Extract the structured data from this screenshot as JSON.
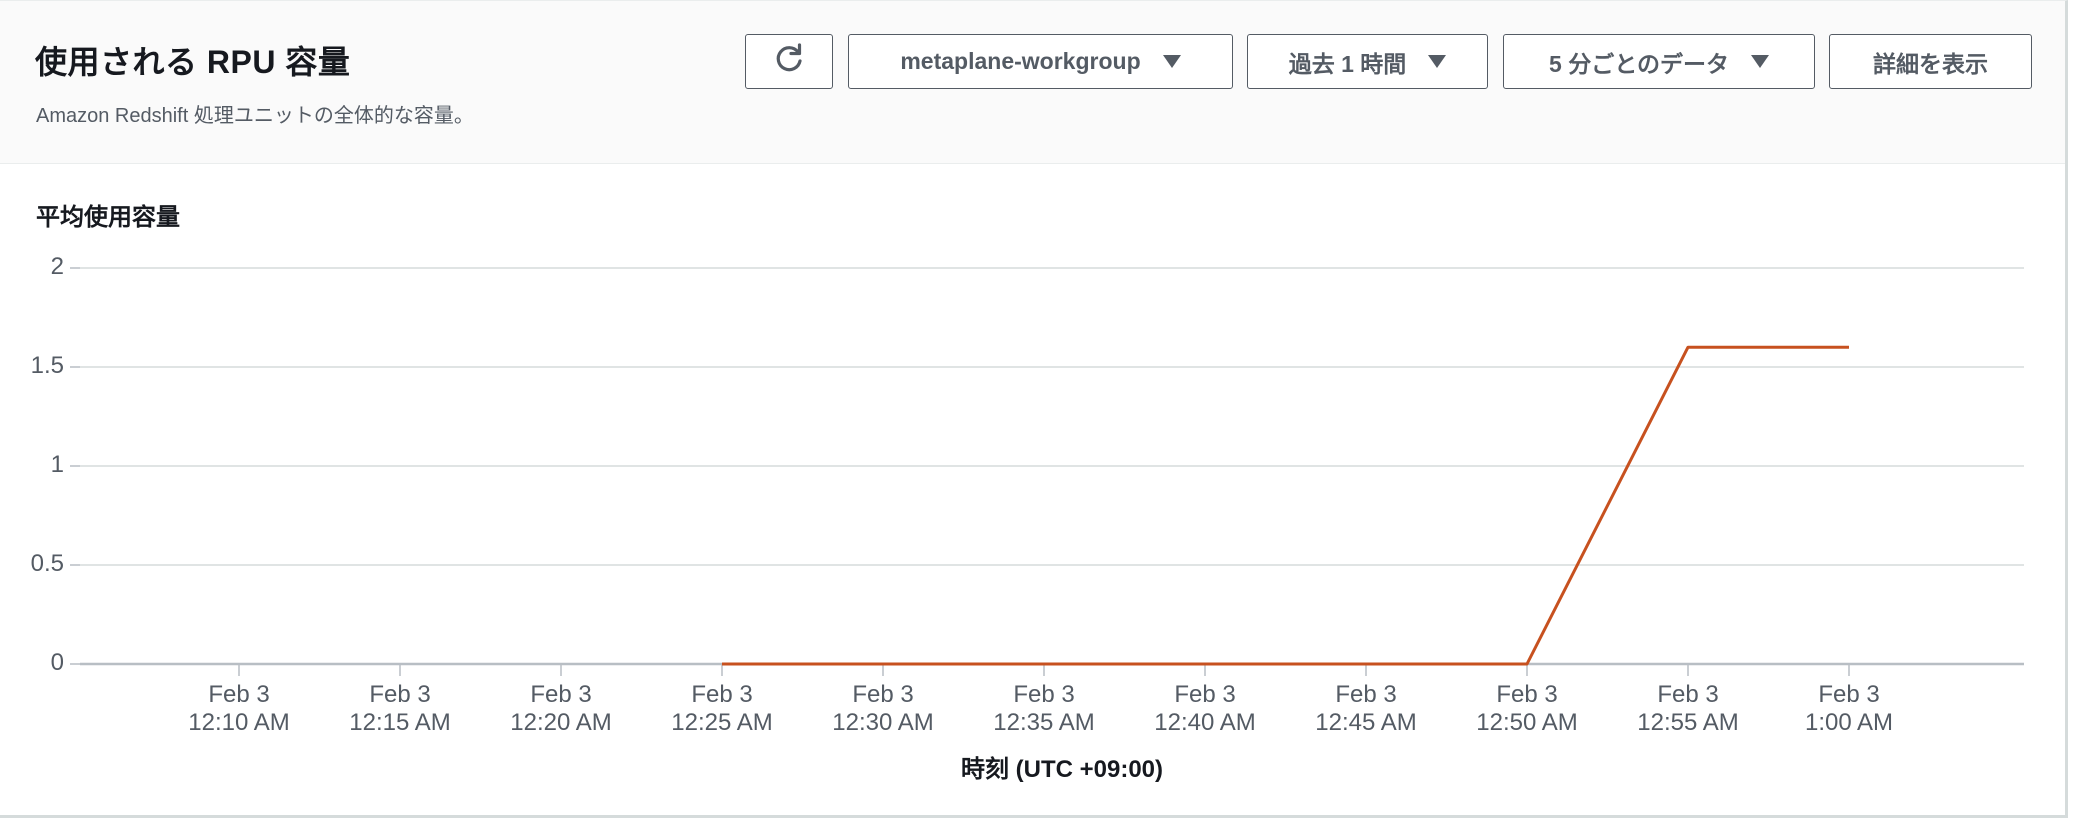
{
  "header": {
    "title": "使用される RPU 容量",
    "subtitle": "Amazon Redshift 処理ユニットの全体的な容量。"
  },
  "toolbar": {
    "refresh_icon": "refresh-icon",
    "workgroup": "metaplane-workgroup",
    "range": "過去 1 時間",
    "period": "5 分ごとのデータ",
    "details": "詳細を表示"
  },
  "chart": {
    "heading": "平均使用容量"
  },
  "chart_data": {
    "type": "line",
    "title": "平均使用容量",
    "xlabel": "時刻 (UTC +09:00)",
    "ylabel": "",
    "ylim": [
      0,
      2
    ],
    "yticks": [
      "2",
      "1.5",
      "1",
      "0.5",
      "0"
    ],
    "x": [
      {
        "date": "Feb 3",
        "time": "12:10 AM"
      },
      {
        "date": "Feb 3",
        "time": "12:15 AM"
      },
      {
        "date": "Feb 3",
        "time": "12:20 AM"
      },
      {
        "date": "Feb 3",
        "time": "12:25 AM"
      },
      {
        "date": "Feb 3",
        "time": "12:30 AM"
      },
      {
        "date": "Feb 3",
        "time": "12:35 AM"
      },
      {
        "date": "Feb 3",
        "time": "12:40 AM"
      },
      {
        "date": "Feb 3",
        "time": "12:45 AM"
      },
      {
        "date": "Feb 3",
        "time": "12:50 AM"
      },
      {
        "date": "Feb 3",
        "time": "12:55 AM"
      },
      {
        "date": "Feb 3",
        "time": "1:00 AM"
      }
    ],
    "series": [
      {
        "color": "#c7511f",
        "values": [
          null,
          null,
          null,
          0,
          0,
          0,
          0,
          0,
          0,
          1.6,
          1.6
        ]
      }
    ],
    "grid": true,
    "legend": "none"
  }
}
